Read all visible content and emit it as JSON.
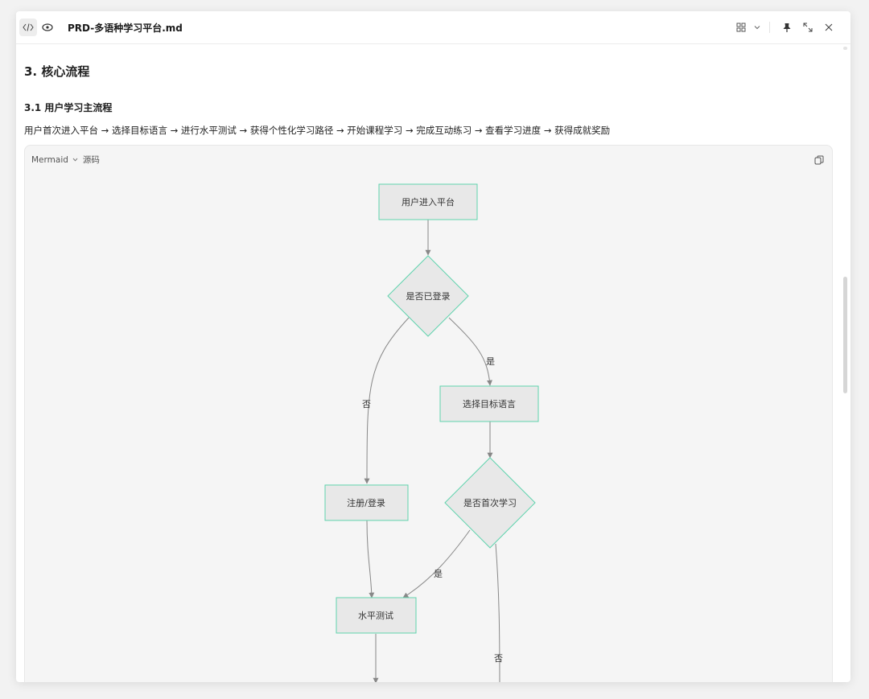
{
  "window": {
    "file_name": "PRD-多语种学习平台.md",
    "view_toggle": {
      "code_icon": "code-icon",
      "preview_icon": "eye-icon"
    },
    "toolbar_icons": [
      "layout-grid-icon",
      "chevron-down-icon",
      "pin-icon",
      "expand-icon",
      "close-icon"
    ]
  },
  "doc": {
    "h3": "3. 核心流程",
    "h31": "3.1 用户学习主流程",
    "paragraph": "用户首次进入平台 → 选择目标语言 → 进行水平测试 → 获得个性化学习路径 → 开始课程学习 → 完成互动练习 → 查看学习进度 → 获得成就奖励"
  },
  "codeblock": {
    "language": "Mermaid",
    "source_tab": "源码"
  },
  "flowchart": {
    "nodes": {
      "enter": "用户进入平台",
      "logged_in": "是否已登录",
      "choose_lang": "选择目标语言",
      "register": "注册/登录",
      "first_time": "是否首次学习",
      "level_test": "水平测试"
    },
    "edges": {
      "yes1": "是",
      "no1": "否",
      "yes2": "是",
      "no2": "否"
    }
  },
  "colors": {
    "node_fill": "#e8e8e8",
    "node_stroke": "#5fd3ad",
    "edge": "#888888",
    "block_bg": "#f5f5f5"
  }
}
